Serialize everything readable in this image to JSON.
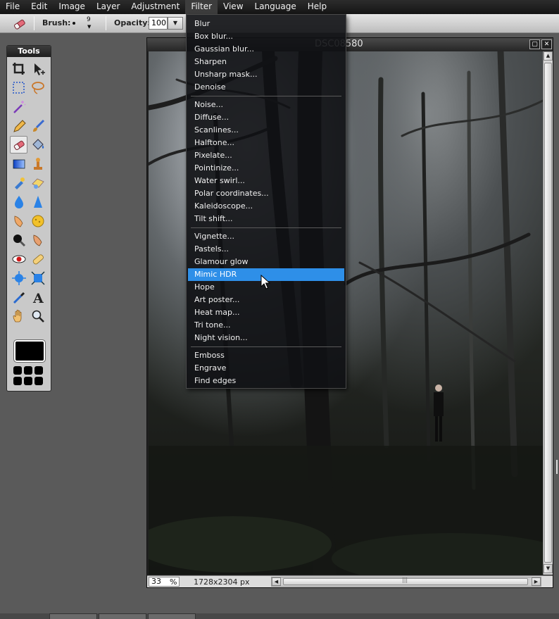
{
  "menubar": {
    "items": [
      "File",
      "Edit",
      "Image",
      "Layer",
      "Adjustment",
      "Filter",
      "View",
      "Language",
      "Help"
    ]
  },
  "options": {
    "brush_label": "Brush:",
    "brush_size": "9",
    "opacity_label": "Opacity:",
    "opacity_value": "100"
  },
  "tools": {
    "title": "Tools",
    "grid": [
      "crop-icon",
      "move-icon",
      "marquee-select-icon",
      "lasso-icon",
      "magic-wand-icon",
      "",
      "pencil-icon",
      "brush-icon",
      "eraser-icon",
      "paint-bucket-icon",
      "gradient-icon",
      "clone-stamp-icon",
      "color-replace-icon",
      "drawing-icon",
      "blur-icon",
      "sharpen-icon",
      "smudge-icon",
      "sponge-icon",
      "dodge-icon",
      "burn-icon",
      "red-eye-icon",
      "spot-heal-icon",
      "bloat-icon",
      "pinch-icon",
      "color-picker-icon",
      "type-icon",
      "hand-icon",
      "zoom-icon"
    ],
    "selected": "eraser-icon",
    "primary_color": "#000000"
  },
  "document": {
    "title": "DSC08580",
    "zoom": "33",
    "zoom_unit": "%",
    "image_size": "1728x2304 px"
  },
  "filter_menu": {
    "groups": [
      [
        "Blur",
        "Box blur...",
        "Gaussian blur...",
        "Sharpen",
        "Unsharp mask...",
        "Denoise"
      ],
      [
        "Noise...",
        "Diffuse...",
        "Scanlines...",
        "Halftone...",
        "Pixelate...",
        "Pointinize...",
        "Water swirl...",
        "Polar coordinates...",
        "Kaleidoscope...",
        "Tilt shift..."
      ],
      [
        "Vignette...",
        "Pastels...",
        "Glamour glow",
        "Mimic HDR",
        "Hope",
        "Art poster...",
        "Heat map...",
        "Tri tone...",
        "Night vision..."
      ],
      [
        "Emboss",
        "Engrave",
        "Find edges"
      ]
    ],
    "highlighted": "Mimic HDR"
  },
  "colors": {
    "menu_highlight": "#2e8fe8",
    "menubar_bg": "#1d1d1d",
    "workspace_bg": "#5a5a5a"
  }
}
